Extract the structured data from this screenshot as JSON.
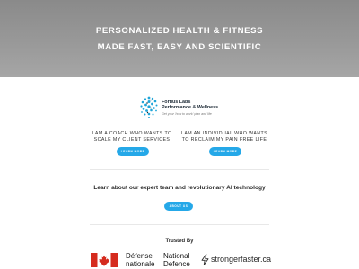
{
  "hero": {
    "line1": "PERSONALIZED HEALTH & FITNESS",
    "line2": "MADE FAST, EASY AND SCIENTIFIC"
  },
  "logo": {
    "name_line1": "Fortius Labs",
    "name_line2": "Performance & Wellness",
    "tagline": "Get your 'how to work' plan and life",
    "icon": "dot-cluster-logo-icon"
  },
  "coach": {
    "line1": "I AM A COACH WHO WANTS TO",
    "line2": "SCALE MY CLIENT SERVICES",
    "button": "LEARN MORE"
  },
  "individual": {
    "line1": "I AM AN INDIVIDUAL WHO WANTS",
    "line2": "TO RECLAIM MY PAIN FREE LIFE",
    "button": "LEARN MORE"
  },
  "team": {
    "text": "Learn about our expert team and revolutionary AI technology",
    "button": "ABOUT US"
  },
  "trusted": {
    "title": "Trusted By",
    "dnd_fr_line1": "Défense",
    "dnd_fr_line2": "nationale",
    "dnd_en_line1": "National",
    "dnd_en_line2": "Defence",
    "partner": "strongerfaster.ca",
    "flag_icon": "canada-flag-icon",
    "partner_icon": "lightning-bolt-icon"
  },
  "colors": {
    "accent": "#25a8e8",
    "hero_bg": "#999999",
    "flag_red": "#d52b1e"
  }
}
